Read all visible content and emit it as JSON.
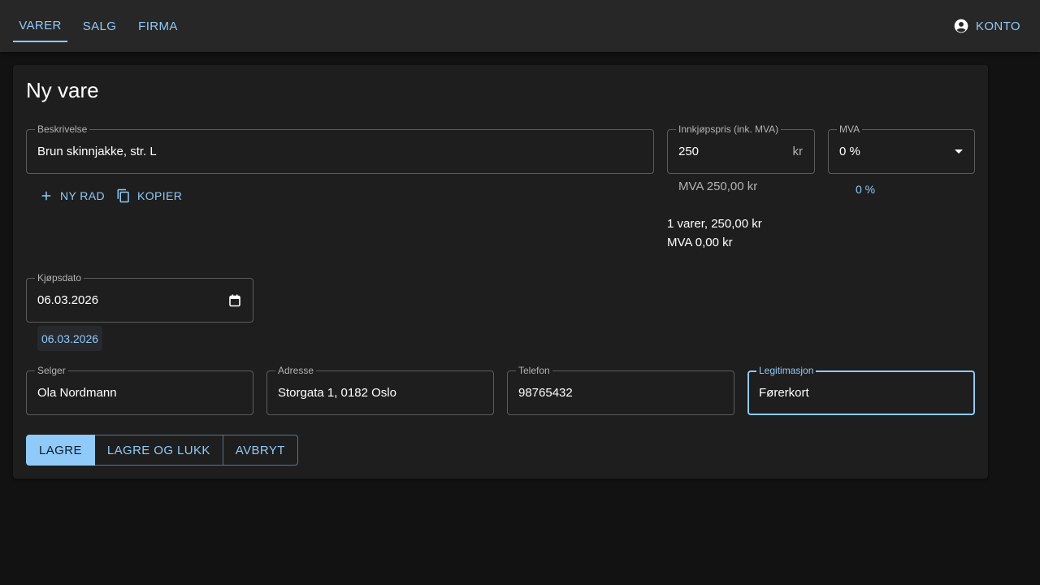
{
  "nav": {
    "tabs": [
      {
        "label": "VARER"
      },
      {
        "label": "SALG"
      },
      {
        "label": "FIRMA"
      }
    ],
    "account_label": "KONTO"
  },
  "form": {
    "title": "Ny vare",
    "beskrivelse": {
      "label": "Beskrivelse",
      "value": "Brun skinnjakke, str. L"
    },
    "innkjopspris": {
      "label": "Innkjøpspris (ink. MVA)",
      "value": "250",
      "suffix": "kr",
      "helper": "MVA 250,00 kr"
    },
    "mva": {
      "label": "MVA",
      "value": "0 %",
      "link": "0 %"
    },
    "row_actions": {
      "new_row": "NY RAD",
      "copy": "KOPIER"
    },
    "summary": {
      "line1": "1 varer, 250,00 kr",
      "line2": "MVA 0,00 kr"
    },
    "kjopsdato": {
      "label": "Kjøpsdato",
      "value": "06.03.2026",
      "chip": "06.03.2026"
    },
    "selger": {
      "label": "Selger",
      "value": "Ola Nordmann"
    },
    "adresse": {
      "label": "Adresse",
      "value": "Storgata 1, 0182 Oslo"
    },
    "telefon": {
      "label": "Telefon",
      "value": "98765432"
    },
    "legitimasjon": {
      "label": "Legitimasjon",
      "value": "Førerkort"
    },
    "buttons": {
      "save": "LAGRE",
      "save_close": "LAGRE OG LUKK",
      "cancel": "AVBRYT"
    }
  },
  "colors": {
    "accent": "#90caf9",
    "background": "#121212",
    "surface": "#1e1e1e",
    "appbar": "#272727"
  },
  "icons": {
    "account": "account-circle-icon",
    "add": "plus-icon",
    "copy": "copy-icon",
    "calendar": "calendar-icon",
    "dropdown": "dropdown-arrow-icon"
  }
}
